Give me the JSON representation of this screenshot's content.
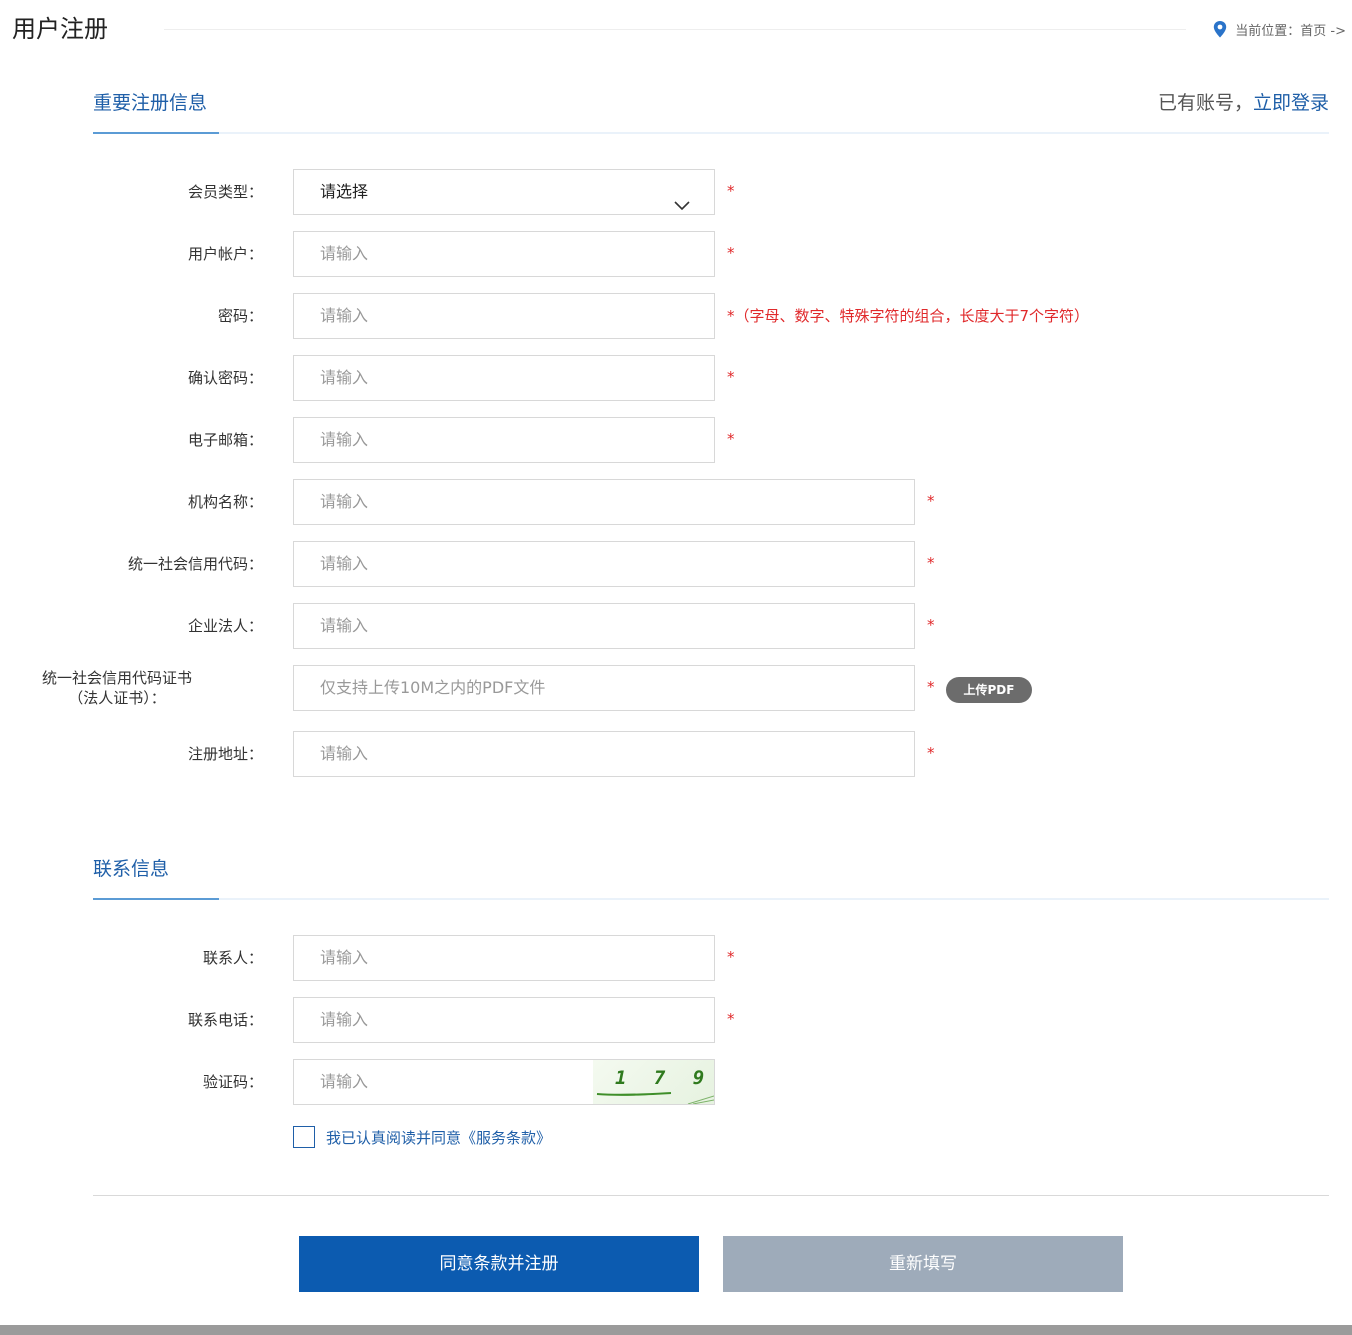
{
  "header": {
    "title": "用户注册",
    "breadcrumb_label": "当前位置：",
    "breadcrumb_home": "首页",
    "breadcrumb_arrow": "->"
  },
  "section_main": {
    "title": "重要注册信息",
    "login_prefix": "已有账号，",
    "login_link": "立即登录"
  },
  "fields_main": {
    "member_type": {
      "label": "会员类型：",
      "value": "请选择"
    },
    "account": {
      "label": "用户帐户：",
      "placeholder": "请输入"
    },
    "password": {
      "label": "密码：",
      "placeholder": "请输入",
      "hint": "（字母、数字、特殊字符的组合，长度大于7个字符）"
    },
    "confirm_password": {
      "label": "确认密码：",
      "placeholder": "请输入"
    },
    "email": {
      "label": "电子邮箱：",
      "placeholder": "请输入"
    },
    "org_name": {
      "label": "机构名称：",
      "placeholder": "请输入"
    },
    "credit_code": {
      "label": "统一社会信用代码：",
      "placeholder": "请输入"
    },
    "legal_person": {
      "label": "企业法人：",
      "placeholder": "请输入"
    },
    "certificate": {
      "label_line1": "统一社会信用代码证书",
      "label_line2": "（法人证书）：",
      "placeholder": "仅支持上传10M之内的PDF文件",
      "upload_label": "上传PDF"
    },
    "address": {
      "label": "注册地址：",
      "placeholder": "请输入"
    }
  },
  "section_contact": {
    "title": "联系信息"
  },
  "fields_contact": {
    "contact_person": {
      "label": "联系人：",
      "placeholder": "请输入"
    },
    "phone": {
      "label": "联系电话：",
      "placeholder": "请输入"
    },
    "captcha": {
      "label": "验证码：",
      "placeholder": "请输入",
      "image_text": "1 7 9"
    }
  },
  "required_mark": "*",
  "agreement": {
    "text": "我已认真阅读并同意《服务条款》",
    "checked": false
  },
  "buttons": {
    "submit": "同意条款并注册",
    "reset": "重新填写"
  },
  "colors": {
    "accent": "#1f5fa8",
    "primary_button": "#0c5bb0",
    "secondary_button": "#9eabba",
    "required": "#e0292b"
  }
}
